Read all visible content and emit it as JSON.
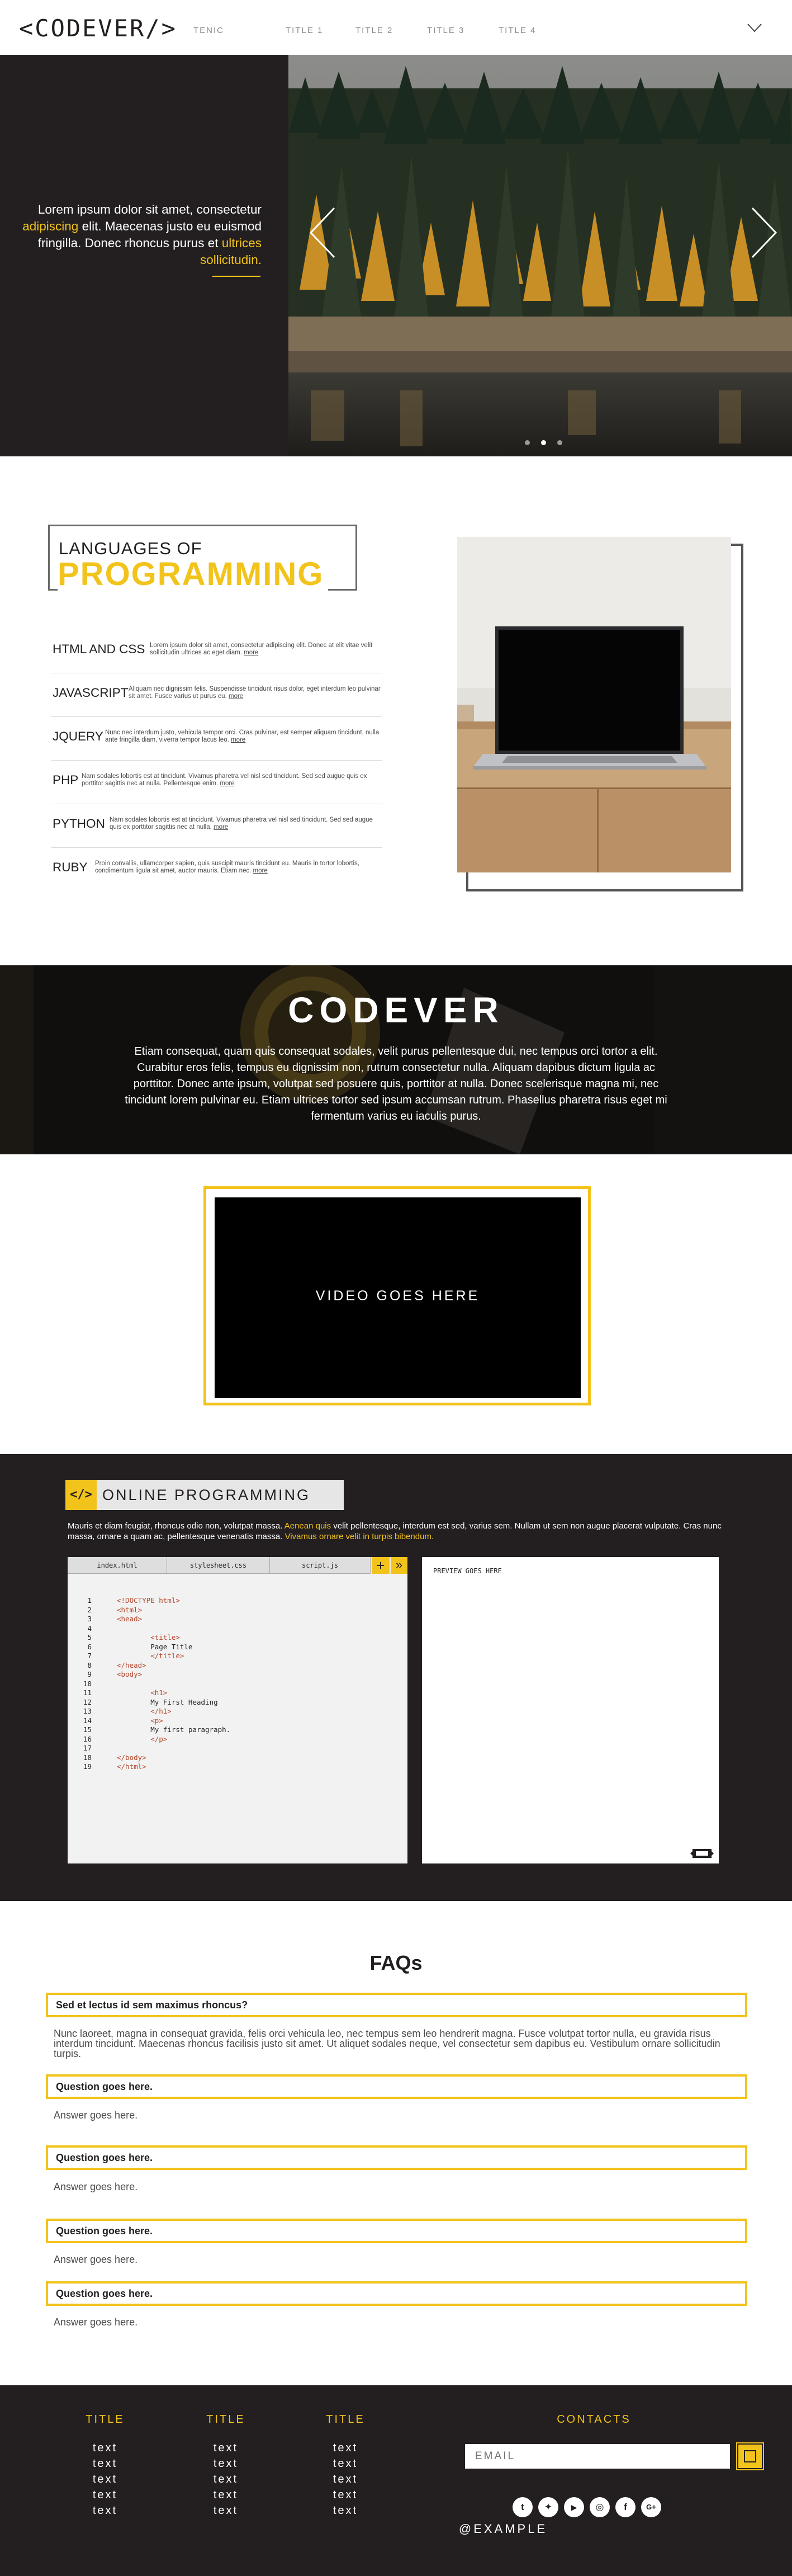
{
  "header": {
    "logo": "<CODEVER/>",
    "tagline": "TENIC",
    "nav": [
      "TITLE 1",
      "TITLE 2",
      "TITLE 3",
      "TITLE 4"
    ],
    "menu_icon": "chevron-down-icon"
  },
  "hero": {
    "text_before": "Lorem ipsum dolor sit amet, consectetur ",
    "text_accent1": "adipiscing",
    "text_middle": " elit. Maecenas justo eu euismod fringilla. Donec rhoncus purus et ",
    "text_accent2": "ultrices sollicitudin.",
    "prev_icon": "chevron-left-icon",
    "next_icon": "chevron-right-icon",
    "slide_count": 3,
    "active_slide": 2
  },
  "languages": {
    "title_line1": "LANGUAGES OF",
    "title_line2": "PROGRAMMING",
    "items": [
      {
        "name": "HTML AND CSS",
        "desc": "Lorem ipsum dolor sit amet, consectetur adipiscing elit. Donec at elit vitae velit sollicitudin ultrices ac eget diam.",
        "more": "more"
      },
      {
        "name": "JAVASCRIPT",
        "desc": "Aliquam nec dignissim felis. Suspendisse tincidunt risus dolor, eget interdum leo pulvinar sit amet. Fusce varius ut purus eu.",
        "more": "more"
      },
      {
        "name": "JQUERY",
        "desc": "Nunc nec interdum justo, vehicula tempor orci. Cras pulvinar, est semper aliquam tincidunt, nulla ante fringilla diam, viverra tempor lacus leo.",
        "more": "more"
      },
      {
        "name": "PHP",
        "desc": "Nam sodales lobortis est at tincidunt. Vivamus pharetra vel nisl sed tincidunt. Sed sed augue quis ex porttitor sagittis nec at nulla. Pellentesque enim.",
        "more": "more"
      },
      {
        "name": "PYTHON",
        "desc": "Nam sodales lobortis est at tincidunt. Vivamus pharetra vel nisl sed tincidunt. Sed sed augue quis ex porttitor sagittis nec at nulla.",
        "more": "more"
      },
      {
        "name": "RUBY",
        "desc": "Proin convallis, ullamcorper sapien, quis suscipit mauris tincidunt eu. Mauris in tortor lobortis, condimentum ligula sit amet, auctor mauris. Etiam nec.",
        "more": "more"
      }
    ]
  },
  "banner": {
    "title": "CODEVER",
    "text": "Etiam consequat, quam quis consequat sodales, velit purus pellentesque dui, nec tempus orci tortor a elit. Curabitur eros felis, tempus eu dignissim non, rutrum consectetur nulla. Aliquam dapibus dictum ligula ac porttitor. Donec ante ipsum, volutpat sed posuere quis, porttitor at nulla. Donec scelerisque magna mi, nec tincidunt lorem pulvinar eu. Etiam ultrices tortor sed ipsum accumsan rutrum. Phasellus pharetra risus eget mi fermentum varius eu iaculis purus."
  },
  "video": {
    "label": "VIDEO GOES HERE"
  },
  "programming": {
    "icon": "</>",
    "title": "ONLINE PROGRAMMING",
    "desc_1": "Mauris et diam feugiat, rhoncus odio non, volutpat massa. ",
    "desc_accent1": "Aenean quis",
    "desc_2": " velit pellentesque, interdum est sed, varius sem. Nullam ut sem non augue placerat vulputate. Cras nunc massa, ornare a quam ac, pellentesque venenatis massa. ",
    "desc_accent2": "Vivamus ornare velit in turpis bibendum.",
    "tabs": [
      "index.html",
      "stylesheet.css",
      "script.js"
    ],
    "add_label": "+",
    "forward_label": "»",
    "code_lines": [
      {
        "n": "1",
        "t": "<!DOCTYPE html>",
        "tag": true,
        "indent": 0
      },
      {
        "n": "2",
        "t": "<html>",
        "tag": true,
        "indent": 0
      },
      {
        "n": "3",
        "t": "<head>",
        "tag": true,
        "indent": 0
      },
      {
        "n": "4",
        "t": "",
        "tag": false,
        "indent": 0
      },
      {
        "n": "5",
        "t": "<title>",
        "tag": true,
        "indent": 2
      },
      {
        "n": "6",
        "t": "Page Title",
        "tag": false,
        "indent": 2
      },
      {
        "n": "7",
        "t": "</title>",
        "tag": true,
        "indent": 2
      },
      {
        "n": "8",
        "t": "</head>",
        "tag": true,
        "indent": 0
      },
      {
        "n": "9",
        "t": "<body>",
        "tag": true,
        "indent": 0
      },
      {
        "n": "10",
        "t": "",
        "tag": false,
        "indent": 0
      },
      {
        "n": "11",
        "t": "<h1>",
        "tag": true,
        "indent": 2
      },
      {
        "n": "12",
        "t": "My First Heading",
        "tag": false,
        "indent": 2
      },
      {
        "n": "13",
        "t": "</h1>",
        "tag": true,
        "indent": 2
      },
      {
        "n": "14",
        "t": "<p>",
        "tag": true,
        "indent": 2
      },
      {
        "n": "15",
        "t": "My first paragraph.",
        "tag": false,
        "indent": 2
      },
      {
        "n": "16",
        "t": "</p>",
        "tag": true,
        "indent": 2
      },
      {
        "n": "17",
        "t": "",
        "tag": false,
        "indent": 0
      },
      {
        "n": "18",
        "t": "</body>",
        "tag": true,
        "indent": 0
      },
      {
        "n": "19",
        "t": "</html>",
        "tag": true,
        "indent": 0
      }
    ],
    "preview_label": "PREVIEW GOES HERE",
    "expand_icon": "expand-icon"
  },
  "faq": {
    "title": "FAQs",
    "items": [
      {
        "q": "Sed et lectus id sem maximus rhoncus?",
        "a": "Nunc laoreet, magna in consequat gravida, felis orci vehicula leo, nec tempus sem leo hendrerit magna. Fusce volutpat tortor nulla, eu gravida risus interdum tincidunt. Maecenas rhoncus facilisis justo sit amet. Ut aliquet sodales neque, vel consectetur sem dapibus eu. Vestibulum ornare sollicitudin turpis."
      },
      {
        "q": "Question goes here.",
        "a": "Answer goes here."
      },
      {
        "q": "Question goes here.",
        "a": "Answer goes here."
      },
      {
        "q": "Question goes here.",
        "a": "Answer goes here."
      },
      {
        "q": "Question goes here.",
        "a": "Answer goes here."
      }
    ]
  },
  "footer": {
    "columns": [
      {
        "title": "TITLE",
        "links": [
          "text",
          "text",
          "text",
          "text",
          "text"
        ]
      },
      {
        "title": "TITLE",
        "links": [
          "text",
          "text",
          "text",
          "text",
          "text"
        ]
      },
      {
        "title": "TITLE",
        "links": [
          "text",
          "text",
          "text",
          "text",
          "text"
        ]
      }
    ],
    "contacts_title": "CONTACTS",
    "email_placeholder": "EMAIL",
    "social": [
      {
        "icon": "tumblr-icon",
        "glyph": "t"
      },
      {
        "icon": "twitter-icon",
        "glyph": "✦"
      },
      {
        "icon": "youtube-icon",
        "glyph": "▶"
      },
      {
        "icon": "instagram-icon",
        "glyph": "◎"
      },
      {
        "icon": "facebook-icon",
        "glyph": "f"
      },
      {
        "icon": "google-plus-icon",
        "glyph": "G+"
      }
    ],
    "handle": "@EXAMPLE"
  },
  "colors": {
    "accent": "#f2c31b",
    "dark": "#231f20"
  }
}
